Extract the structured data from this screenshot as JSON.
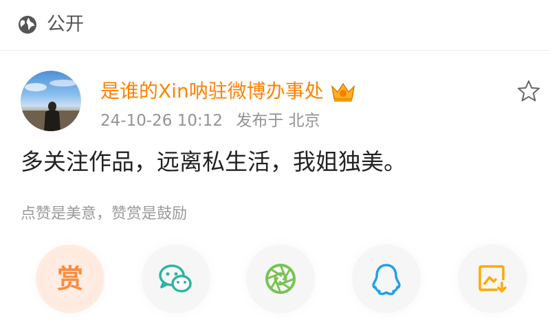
{
  "topbar": {
    "visibility_label": "公开",
    "icon": "globe-icon"
  },
  "post": {
    "username": "是谁的Xin呐驻微博办事处",
    "badge": "crown-icon",
    "timestamp": "24-10-26 10:12",
    "source": "发布于 北京",
    "content": "多关注作品，远离私生活，我姐独美。"
  },
  "reward_hint": "点赞是美意，赞赏是鼓励",
  "share": {
    "reward_label": "赏",
    "buttons": [
      {
        "name": "reward-button",
        "icon": "reward-icon"
      },
      {
        "name": "wechat-share-button",
        "icon": "wechat-icon",
        "color": "#2dc100"
      },
      {
        "name": "moments-share-button",
        "icon": "moments-icon",
        "color": "#78c352"
      },
      {
        "name": "qq-share-button",
        "icon": "qq-icon",
        "color": "#1ea0ea"
      },
      {
        "name": "save-image-button",
        "icon": "save-image-icon",
        "color": "#ffa800"
      }
    ]
  },
  "colors": {
    "accent": "#ff8200",
    "text": "#222222",
    "muted": "#939393"
  }
}
